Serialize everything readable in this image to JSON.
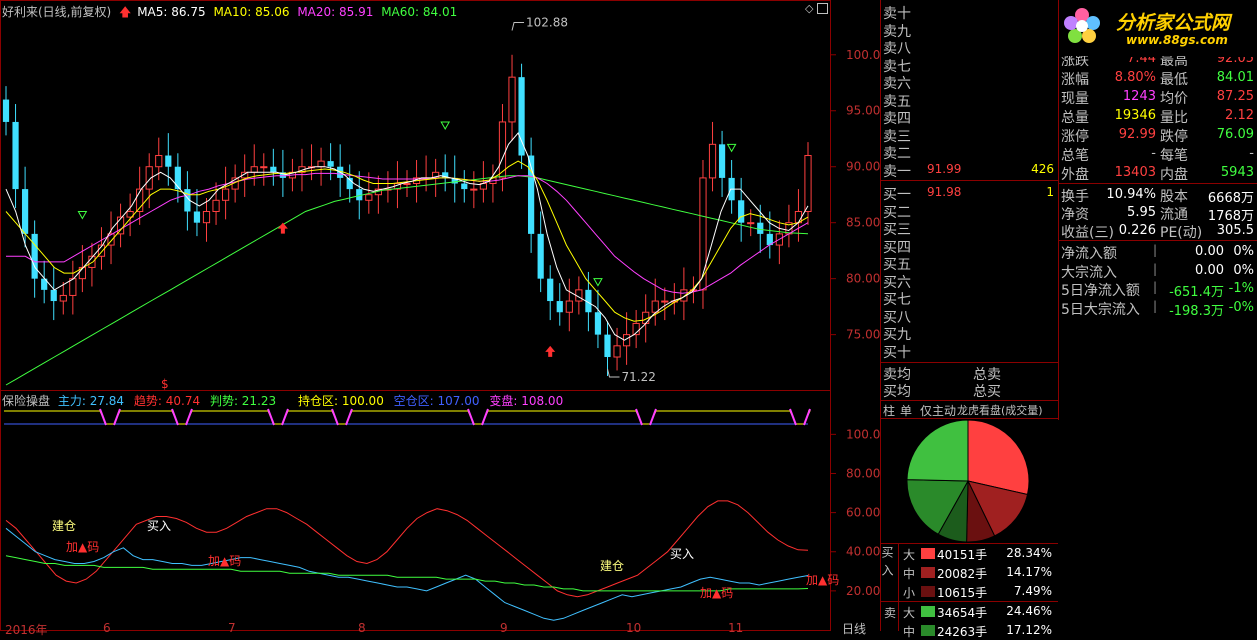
{
  "header": {
    "stock_title": "好利来(日线,前复权)",
    "ma5": "MA5: 86.75",
    "ma10": "MA10: 85.06",
    "ma20": "MA20: 85.91",
    "ma60": "MA60: 84.01"
  },
  "indicator_header": {
    "name": "保险操盘",
    "zhuli": "主力: 27.84",
    "qushi": "趋势: 40.74",
    "panshi": "判势: 21.23",
    "chicang": "持仓区: 100.00",
    "kongcang": "空仓区: 107.00",
    "biandong": "变盘: 108.00"
  },
  "annotations": {
    "high_label": "102.88",
    "low_label": "71.22",
    "jiancang": "建仓",
    "jiama": "加▲码",
    "mairu": "买入",
    "dollar": "$"
  },
  "axis": {
    "main_ticks": [
      "100.0",
      "95.00",
      "90.00",
      "85.00",
      "80.00",
      "75.00"
    ],
    "ind_ticks": [
      "100.0",
      "80.00",
      "60.00",
      "40.00",
      "20.00"
    ],
    "bottom_dates": [
      "2016年",
      "6",
      "7",
      "8",
      "9",
      "10",
      "11"
    ],
    "period": "日线"
  },
  "logo": {
    "name": "分析家公式网",
    "url": "www.88gs.com"
  },
  "order_book": {
    "sell": [
      "卖十",
      "卖九",
      "卖八",
      "卖七",
      "卖六",
      "卖五",
      "卖四",
      "卖三",
      "卖二",
      "卖一"
    ],
    "sell1_price": "91.99",
    "sell1_vol": "426",
    "buy": [
      "买一",
      "买二",
      "买三",
      "买四",
      "买五",
      "买六",
      "买七",
      "买八",
      "买九",
      "买十"
    ],
    "buy1_price": "91.98",
    "buy1_vol": "1",
    "avg_sell": "卖均",
    "avg_buy": "买均",
    "total_sell": "总卖",
    "total_buy": "总买"
  },
  "stats": [
    {
      "l1": "涨跌",
      "v1": "7.44",
      "l2": "最高",
      "v2": "92.05"
    },
    {
      "l1": "涨幅",
      "v1": "8.80%",
      "l2": "最低",
      "v2": "84.01"
    },
    {
      "l1": "现量",
      "v1": "1243",
      "l2": "均价",
      "v2": "87.25"
    },
    {
      "l1": "总量",
      "v1": "19346",
      "l2": "量比",
      "v2": "2.12"
    },
    {
      "l1": "涨停",
      "v1": "92.99",
      "l2": "跌停",
      "v2": "76.09"
    },
    {
      "l1": "总笔",
      "v1": "-",
      "l2": "每笔",
      "v2": "-"
    },
    {
      "l1": "外盘",
      "v1": "13403",
      "l2": "内盘",
      "v2": "5943"
    },
    {
      "l1": "换手",
      "v1": "10.94%",
      "l2": "股本",
      "v2": "6668万"
    },
    {
      "l1": "净资",
      "v1": "5.95",
      "l2": "流通",
      "v2": "1768万"
    },
    {
      "l1": "收益(三)",
      "v1": "0.226",
      "l2": "PE(动)",
      "v2": "305.5"
    }
  ],
  "flows": [
    {
      "label": "净流入额",
      "value": "0.00",
      "pct": "0%"
    },
    {
      "label": "大宗流入",
      "value": "0.00",
      "pct": "0%"
    },
    {
      "label": "5日净流入额",
      "value": "-651.4万",
      "pct": "-1%"
    },
    {
      "label": "5日大宗流入",
      "value": "-198.3万",
      "pct": "-0%"
    }
  ],
  "tabs": [
    "柱",
    "单",
    "仅主动",
    "龙虎看盘(成交量)"
  ],
  "pie": {
    "slices": [
      28.34,
      14.17,
      7.49,
      7.71,
      17.12,
      24.46
    ],
    "colors": [
      "#ff4040",
      "#a02020",
      "#6a1010",
      "#1c5c1c",
      "#2a8a2a",
      "#40c040"
    ]
  },
  "breakdown": {
    "buy_label": "买入",
    "sell_label": "卖",
    "rows": [
      {
        "size": "大",
        "vol": "40151手",
        "pct": "28.34%",
        "color": "#ff4040"
      },
      {
        "size": "中",
        "vol": "20082手",
        "pct": "14.17%",
        "color": "#a02020"
      },
      {
        "size": "小",
        "vol": "10615手",
        "pct": "7.49%",
        "color": "#6a1010"
      },
      {
        "size": "大",
        "vol": "34654手",
        "pct": "24.46%",
        "color": "#40c040"
      },
      {
        "size": "中",
        "vol": "24263手",
        "pct": "17.12%",
        "color": "#2a8a2a"
      }
    ]
  },
  "chart_data": {
    "type": "line",
    "price_high": 102.88,
    "price_low": 71.22,
    "ylim_main": [
      70.5,
      104
    ],
    "ylim_indicator": [
      0,
      115
    ],
    "close": [
      94,
      88,
      84,
      80,
      79,
      78,
      78.5,
      80,
      81,
      82,
      83,
      84,
      85.5,
      86,
      88,
      90,
      91,
      90,
      88,
      86,
      85,
      86,
      87,
      88,
      89,
      89.5,
      90,
      90,
      89.5,
      89,
      89.5,
      90,
      90,
      90.5,
      90,
      89,
      88,
      87,
      87.5,
      88,
      88,
      88.5,
      88.5,
      89,
      89,
      89.5,
      89,
      88.5,
      88,
      88,
      88.5,
      89,
      94,
      98,
      91,
      84,
      80,
      78,
      77,
      78,
      79,
      77,
      75,
      73,
      74,
      75,
      76,
      77,
      78,
      78,
      78,
      79,
      79,
      89,
      92,
      89,
      87,
      85,
      85,
      84,
      83,
      84,
      85,
      86,
      91
    ],
    "ma5": [
      88,
      86,
      83,
      81,
      80,
      79,
      79.5,
      80,
      81,
      82,
      83,
      84.5,
      85.5,
      86.5,
      88,
      89,
      89.5,
      89,
      88,
      87,
      86.5,
      87,
      88,
      88.5,
      89,
      89.5,
      89.5,
      89.5,
      89.5,
      89.3,
      89.5,
      89.8,
      90,
      90,
      89.8,
      89.3,
      88.5,
      88,
      87.8,
      88,
      88.2,
      88.5,
      88.7,
      89,
      89,
      89.2,
      89,
      88.8,
      88.5,
      88.4,
      88.7,
      90,
      92,
      93,
      91,
      88,
      84,
      81,
      79,
      78.5,
      78,
      77.5,
      76.5,
      75,
      74.5,
      75,
      75.8,
      76.8,
      77.5,
      78,
      78.3,
      78.8,
      80,
      83,
      86,
      88,
      88,
      87,
      86,
      85,
      84.5,
      84.3,
      85,
      86.5
    ],
    "ma10": [
      86,
      85,
      84,
      83,
      82,
      81,
      80.5,
      80.5,
      81,
      81.5,
      82.5,
      83.5,
      84.5,
      85.5,
      86.5,
      87.5,
      88,
      88,
      87.8,
      87.5,
      87.5,
      87.8,
      88,
      88.3,
      88.7,
      89,
      89.2,
      89.3,
      89.4,
      89.4,
      89.5,
      89.6,
      89.7,
      89.8,
      89.7,
      89.5,
      89.2,
      88.8,
      88.5,
      88.5,
      88.5,
      88.6,
      88.7,
      88.8,
      88.9,
      89,
      89,
      88.9,
      88.8,
      88.7,
      88.8,
      89.3,
      90,
      90.5,
      90,
      88.8,
      87,
      85,
      83,
      81.5,
      80,
      79,
      78,
      77,
      76.5,
      76.2,
      76.3,
      76.7,
      77.2,
      77.8,
      78.3,
      79,
      80,
      81.5,
      83,
      84.5,
      85.5,
      85.8,
      85.6,
      85.3,
      85,
      84.8,
      85,
      85.5
    ],
    "ma20": [
      82,
      82,
      82,
      81.5,
      81.5,
      81.5,
      81.5,
      82,
      82.5,
      83,
      83.5,
      84,
      84.5,
      85,
      85.5,
      86,
      86.5,
      87,
      87.3,
      87.5,
      87.8,
      88,
      88.3,
      88.5,
      88.7,
      88.9,
      89,
      89.1,
      89.2,
      89.2,
      89.3,
      89.3,
      89.4,
      89.4,
      89.4,
      89.3,
      89.2,
      89.1,
      89,
      88.9,
      88.9,
      88.9,
      88.9,
      88.9,
      89,
      89,
      89,
      88.9,
      88.8,
      88.7,
      88.7,
      88.8,
      89,
      89.2,
      89.2,
      89,
      88.5,
      87.8,
      87,
      86,
      85,
      84,
      83,
      82,
      81.3,
      80.6,
      80,
      79.5,
      79,
      78.8,
      78.7,
      78.8,
      79,
      79.5,
      80,
      80.5,
      81.2,
      81.8,
      82.4,
      83,
      83.5,
      84,
      84.5,
      85
    ],
    "ma60": [
      70.5,
      71,
      71.5,
      72,
      72.5,
      73,
      73.5,
      74,
      74.5,
      75,
      75.5,
      76,
      76.5,
      77,
      77.5,
      78,
      78.5,
      79,
      79.5,
      80,
      80.5,
      81,
      81.5,
      82,
      82.5,
      83,
      83.5,
      84,
      84.5,
      85,
      85.5,
      86,
      86.3,
      86.6,
      86.9,
      87.1,
      87.3,
      87.5,
      87.7,
      87.9,
      88,
      88.1,
      88.2,
      88.3,
      88.4,
      88.5,
      88.6,
      88.7,
      88.8,
      88.9,
      89,
      89.1,
      89.2,
      89.2,
      89.1,
      89,
      88.8,
      88.6,
      88.4,
      88.2,
      88,
      87.8,
      87.6,
      87.4,
      87.2,
      87,
      86.8,
      86.6,
      86.4,
      86.2,
      86,
      85.8,
      85.6,
      85.4,
      85.2,
      85,
      84.8,
      84.6,
      84.4,
      84.3,
      84.2,
      84.1,
      84.05,
      84.01
    ],
    "zhuli": [
      52,
      48,
      44,
      40,
      38,
      36,
      35,
      34,
      34,
      35,
      37,
      40,
      42,
      38,
      36,
      36,
      35,
      34,
      34,
      33,
      33,
      34,
      35,
      36,
      37,
      37,
      36,
      35,
      34,
      33,
      32,
      30,
      29,
      28,
      27,
      27,
      26,
      25,
      24,
      23,
      22,
      22,
      21,
      20,
      22,
      24,
      26,
      28,
      26,
      22,
      18,
      14,
      12,
      10,
      8,
      6,
      5,
      6,
      8,
      10,
      12,
      14,
      16,
      18,
      17,
      18,
      19,
      20,
      21,
      22,
      24,
      26,
      27,
      26,
      25,
      24,
      24,
      23,
      24,
      25,
      26,
      27,
      27.84
    ],
    "qushi": [
      56,
      52,
      46,
      40,
      34,
      28,
      25,
      24,
      26,
      30,
      36,
      42,
      48,
      54,
      56,
      58,
      58,
      57,
      55,
      52,
      50,
      50,
      52,
      55,
      58,
      60,
      62,
      62,
      60,
      57,
      54,
      50,
      46,
      42,
      38,
      35,
      34,
      36,
      40,
      46,
      52,
      57,
      60,
      62,
      61,
      59,
      56,
      52,
      48,
      44,
      40,
      36,
      32,
      28,
      24,
      20,
      18,
      17,
      18,
      20,
      22,
      24,
      26,
      28,
      32,
      36,
      40,
      46,
      52,
      58,
      63,
      66,
      66,
      64,
      60,
      55,
      50,
      46,
      43,
      41,
      40.74
    ],
    "panshi": [
      38,
      37,
      36,
      35,
      34,
      34,
      33,
      33,
      33,
      33,
      32,
      32,
      32,
      32,
      32,
      31,
      31,
      31,
      31,
      31,
      31,
      31,
      31,
      31,
      30,
      30,
      30,
      30,
      30,
      29,
      29,
      29,
      29,
      29,
      28,
      28,
      28,
      28,
      28,
      28,
      27,
      27,
      27,
      27,
      27,
      26,
      26,
      26,
      26,
      25,
      25,
      24,
      24,
      23,
      23,
      22,
      22,
      21,
      21,
      20,
      20,
      20,
      20,
      20,
      20,
      20,
      20,
      20,
      20,
      20,
      20,
      20,
      20,
      20,
      21,
      21,
      21,
      21,
      21,
      21,
      21,
      21,
      21.23
    ]
  }
}
